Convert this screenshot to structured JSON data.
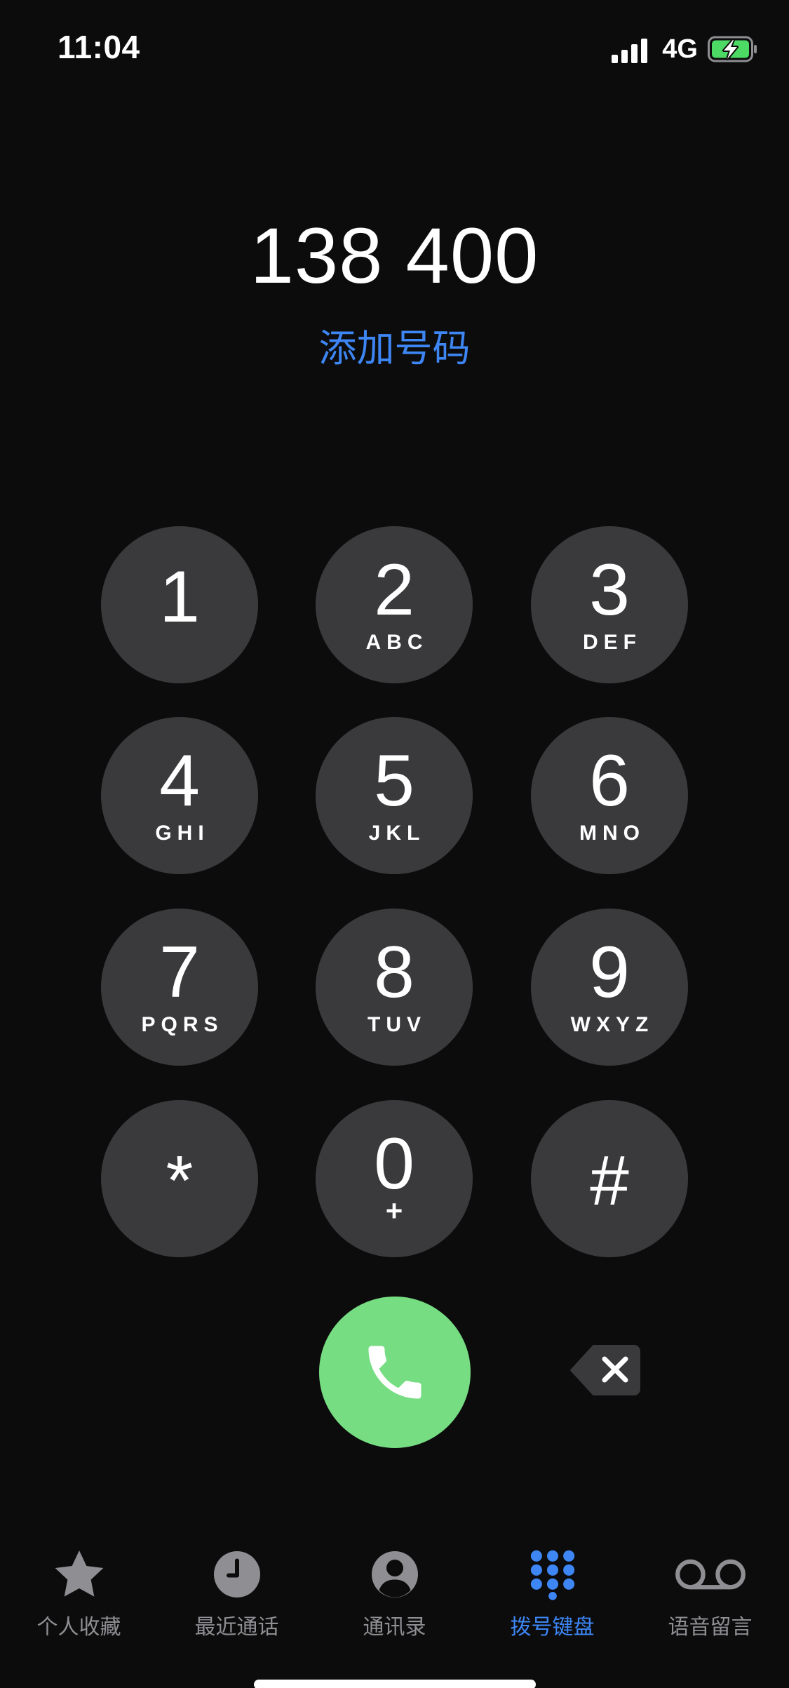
{
  "status_bar": {
    "time": "11:04",
    "network": "4G",
    "signal_bars": 4,
    "battery_state": "charging",
    "battery_color": "#4cd964"
  },
  "dialer": {
    "number": "138 400",
    "add_number_label": "添加号码",
    "add_number_color": "#3d86f4"
  },
  "keypad": [
    {
      "digit": "1",
      "letters": ""
    },
    {
      "digit": "2",
      "letters": "ABC"
    },
    {
      "digit": "3",
      "letters": "DEF"
    },
    {
      "digit": "4",
      "letters": "GHI"
    },
    {
      "digit": "5",
      "letters": "JKL"
    },
    {
      "digit": "6",
      "letters": "MNO"
    },
    {
      "digit": "7",
      "letters": "PQRS"
    },
    {
      "digit": "8",
      "letters": "TUV"
    },
    {
      "digit": "9",
      "letters": "WXYZ"
    },
    {
      "digit": "*",
      "letters": ""
    },
    {
      "digit": "0",
      "letters": "+"
    },
    {
      "digit": "#",
      "letters": ""
    }
  ],
  "actions": {
    "call_icon": "phone-icon",
    "call_color": "#76dd82",
    "delete_icon": "backspace-icon"
  },
  "tab_bar": {
    "active_color": "#3d86f4",
    "inactive_color": "#8e8e93",
    "tabs": [
      {
        "label": "个人收藏",
        "icon": "star-icon",
        "active": false
      },
      {
        "label": "最近通话",
        "icon": "clock-icon",
        "active": false
      },
      {
        "label": "通讯录",
        "icon": "contact-icon",
        "active": false
      },
      {
        "label": "拨号键盘",
        "icon": "keypad-icon",
        "active": true
      },
      {
        "label": "语音留言",
        "icon": "voicemail-icon",
        "active": false
      }
    ]
  }
}
